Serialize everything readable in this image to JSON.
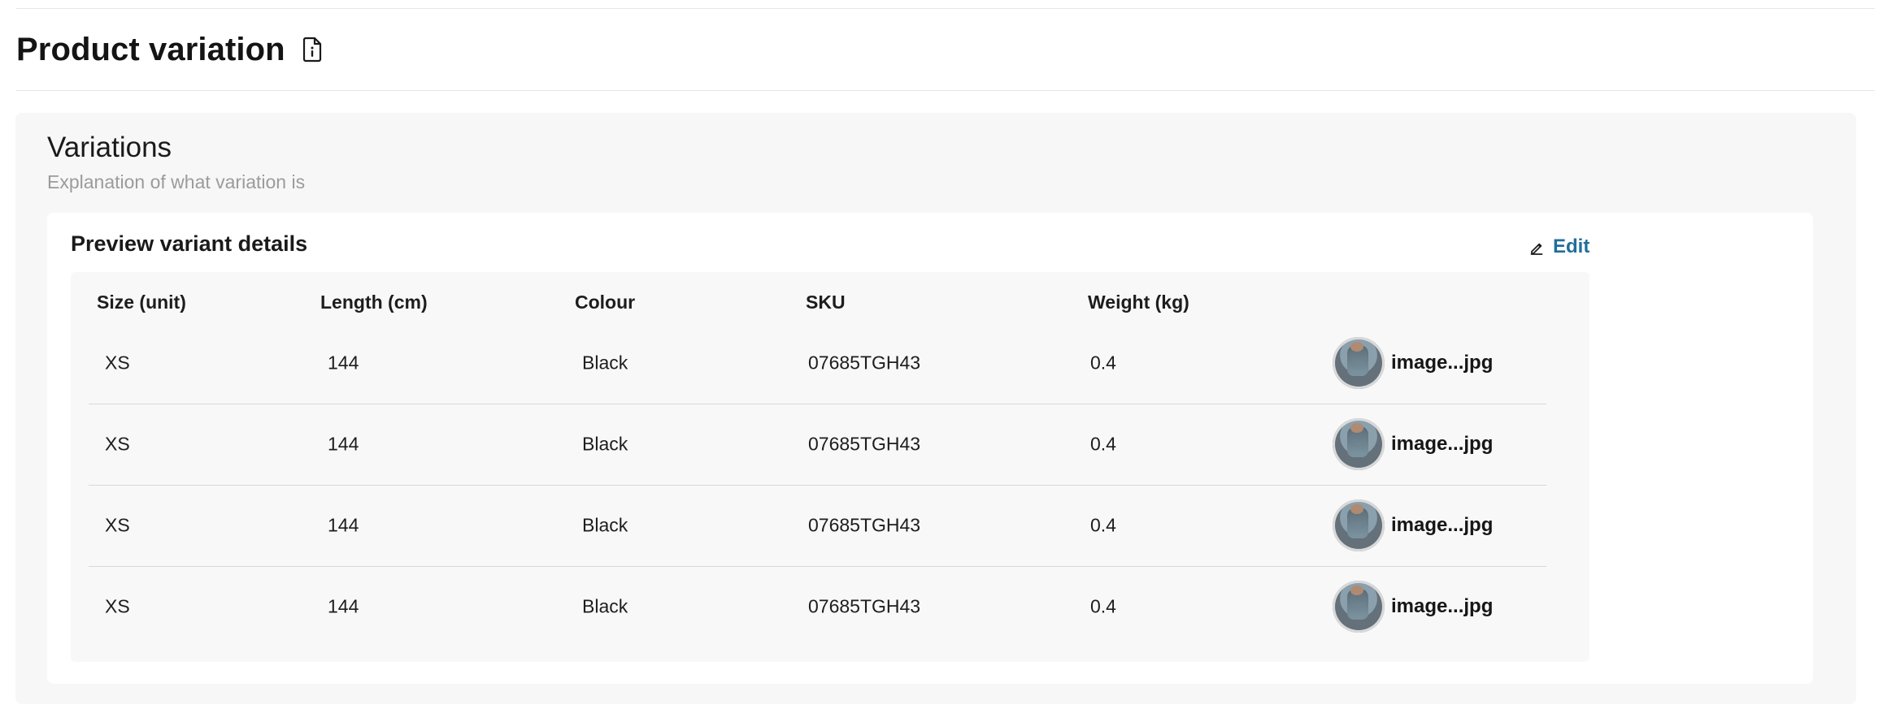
{
  "page": {
    "title": "Product variation",
    "title_icon": "document-icon"
  },
  "variations": {
    "title": "Variations",
    "subtitle": "Explanation of what variation is",
    "preview": {
      "title": "Preview variant details",
      "edit_label": "Edit",
      "edit_icon": "edit-icon"
    },
    "table": {
      "headers": [
        "Size (unit)",
        "Length (cm)",
        "Colour",
        "SKU",
        "Weight (kg)"
      ],
      "rows": [
        {
          "size": "XS",
          "length": "144",
          "colour": "Black",
          "sku": "07685TGH43",
          "weight": "0.4",
          "file": "image...jpg"
        },
        {
          "size": "XS",
          "length": "144",
          "colour": "Black",
          "sku": "07685TGH43",
          "weight": "0.4",
          "file": "image...jpg"
        },
        {
          "size": "XS",
          "length": "144",
          "colour": "Black",
          "sku": "07685TGH43",
          "weight": "0.4",
          "file": "image...jpg"
        },
        {
          "size": "XS",
          "length": "144",
          "colour": "Black",
          "sku": "07685TGH43",
          "weight": "0.4",
          "file": "image...jpg"
        }
      ]
    }
  },
  "colors": {
    "panel_bg": "#f7f7f7",
    "card_bg": "#ffffff",
    "accent": "#1f6f9a",
    "text": "#1d1d1d",
    "subtle_text": "#9b9b9b",
    "divider": "#d8d8d8"
  }
}
